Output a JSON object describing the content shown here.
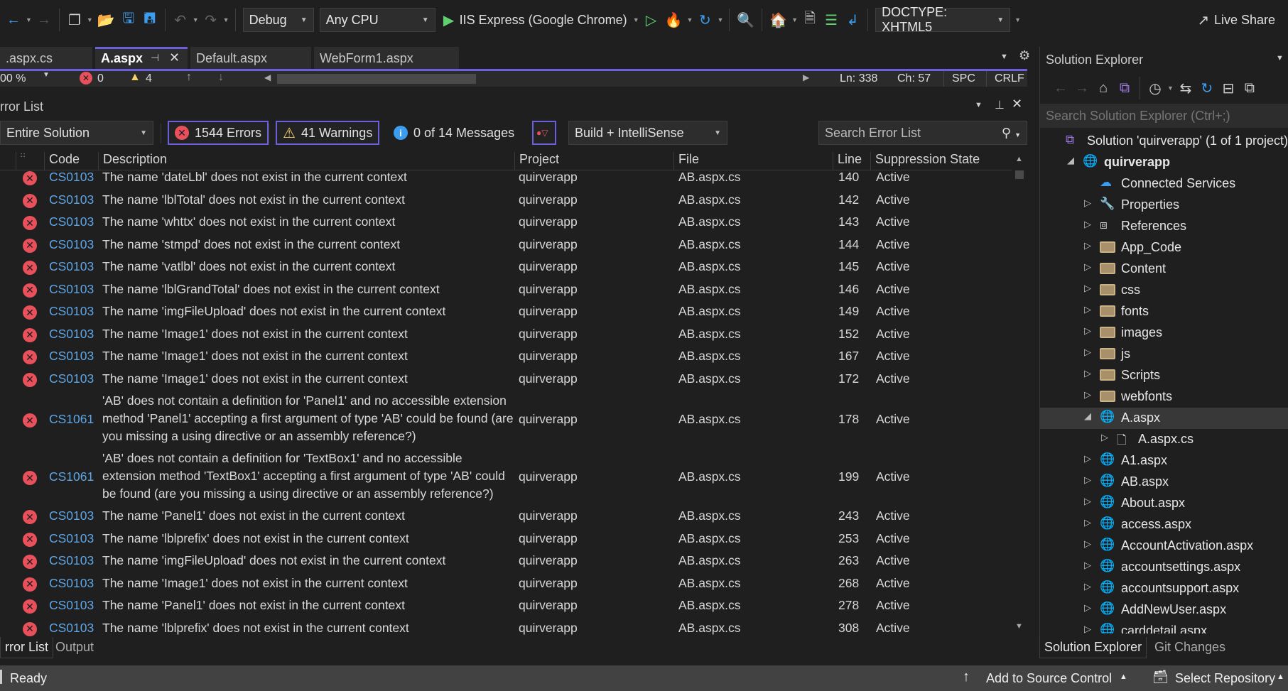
{
  "toolbar": {
    "config": "Debug",
    "platform": "Any CPU",
    "run_target": "IIS Express (Google Chrome)",
    "doctype": "DOCTYPE: XHTML5",
    "live_share": "Live Share"
  },
  "doc_tabs": [
    {
      "label": ".aspx.cs",
      "active": false
    },
    {
      "label": "A.aspx",
      "active": true
    },
    {
      "label": "Default.aspx",
      "active": false
    },
    {
      "label": "WebForm1.aspx",
      "active": false
    }
  ],
  "editor_status": {
    "zoom": "00 %",
    "errors": "0",
    "warnings": "4",
    "ln": "Ln: 338",
    "ch": "Ch: 57",
    "spc": "SPC",
    "crlf": "CRLF"
  },
  "error_list": {
    "title": "rror List",
    "scope": "Entire Solution",
    "errors_btn": "1544 Errors",
    "warnings_btn": "41 Warnings",
    "messages_btn": "0 of 14 Messages",
    "source": "Build + IntelliSense",
    "search_placeholder": "Search Error List",
    "columns": {
      "code": "Code",
      "description": "Description",
      "project": "Project",
      "file": "File",
      "line": "Line",
      "suppression": "Suppression State"
    },
    "rows": [
      {
        "code": "CS0103",
        "description": "The name 'dateLbl' does not exist in the current context",
        "project": "quirverapp",
        "file": "AB.aspx.cs",
        "line": "140",
        "suppression": "Active"
      },
      {
        "code": "CS0103",
        "description": "The name 'lblTotal' does not exist in the current context",
        "project": "quirverapp",
        "file": "AB.aspx.cs",
        "line": "142",
        "suppression": "Active"
      },
      {
        "code": "CS0103",
        "description": "The name 'whttx' does not exist in the current context",
        "project": "quirverapp",
        "file": "AB.aspx.cs",
        "line": "143",
        "suppression": "Active"
      },
      {
        "code": "CS0103",
        "description": "The name 'stmpd' does not exist in the current context",
        "project": "quirverapp",
        "file": "AB.aspx.cs",
        "line": "144",
        "suppression": "Active"
      },
      {
        "code": "CS0103",
        "description": "The name 'vatlbl' does not exist in the current context",
        "project": "quirverapp",
        "file": "AB.aspx.cs",
        "line": "145",
        "suppression": "Active"
      },
      {
        "code": "CS0103",
        "description": "The name 'lblGrandTotal' does not exist in the current context",
        "project": "quirverapp",
        "file": "AB.aspx.cs",
        "line": "146",
        "suppression": "Active"
      },
      {
        "code": "CS0103",
        "description": "The name 'imgFileUpload' does not exist in the current context",
        "project": "quirverapp",
        "file": "AB.aspx.cs",
        "line": "149",
        "suppression": "Active"
      },
      {
        "code": "CS0103",
        "description": "The name 'Image1' does not exist in the current context",
        "project": "quirverapp",
        "file": "AB.aspx.cs",
        "line": "152",
        "suppression": "Active"
      },
      {
        "code": "CS0103",
        "description": "The name 'Image1' does not exist in the current context",
        "project": "quirverapp",
        "file": "AB.aspx.cs",
        "line": "167",
        "suppression": "Active"
      },
      {
        "code": "CS0103",
        "description": "The name 'Image1' does not exist in the current context",
        "project": "quirverapp",
        "file": "AB.aspx.cs",
        "line": "172",
        "suppression": "Active"
      },
      {
        "code": "CS1061",
        "description": "'AB' does not contain a definition for 'Panel1' and no accessible extension method 'Panel1' accepting a first argument of type 'AB' could be found (are you missing a using directive or an assembly reference?)",
        "project": "quirverapp",
        "file": "AB.aspx.cs",
        "line": "178",
        "suppression": "Active"
      },
      {
        "code": "CS1061",
        "description": "'AB' does not contain a definition for 'TextBox1' and no accessible extension method 'TextBox1' accepting a first argument of type 'AB' could be found (are you missing a using directive or an assembly reference?)",
        "project": "quirverapp",
        "file": "AB.aspx.cs",
        "line": "199",
        "suppression": "Active"
      },
      {
        "code": "CS0103",
        "description": "The name 'Panel1' does not exist in the current context",
        "project": "quirverapp",
        "file": "AB.aspx.cs",
        "line": "243",
        "suppression": "Active"
      },
      {
        "code": "CS0103",
        "description": "The name 'lblprefix' does not exist in the current context",
        "project": "quirverapp",
        "file": "AB.aspx.cs",
        "line": "253",
        "suppression": "Active"
      },
      {
        "code": "CS0103",
        "description": "The name 'imgFileUpload' does not exist in the current context",
        "project": "quirverapp",
        "file": "AB.aspx.cs",
        "line": "263",
        "suppression": "Active"
      },
      {
        "code": "CS0103",
        "description": "The name 'Image1' does not exist in the current context",
        "project": "quirverapp",
        "file": "AB.aspx.cs",
        "line": "268",
        "suppression": "Active"
      },
      {
        "code": "CS0103",
        "description": "The name 'Panel1' does not exist in the current context",
        "project": "quirverapp",
        "file": "AB.aspx.cs",
        "line": "278",
        "suppression": "Active"
      },
      {
        "code": "CS0103",
        "description": "The name 'lblprefix' does not exist in the current context",
        "project": "quirverapp",
        "file": "AB.aspx.cs",
        "line": "308",
        "suppression": "Active"
      }
    ]
  },
  "bottom_tabs": [
    "rror List",
    "Output"
  ],
  "solution_explorer": {
    "title": "Solution Explorer",
    "search_placeholder": "Search Solution Explorer (Ctrl+;)",
    "tree": [
      {
        "label": "Solution 'quirverapp' (1 of 1 project)",
        "icon": "solution-icon",
        "depth": 0,
        "twisty": ""
      },
      {
        "label": "quirverapp",
        "icon": "web-project-icon",
        "depth": 1,
        "twisty": "expanded",
        "bold": true
      },
      {
        "label": "Connected Services",
        "icon": "connected-services-icon",
        "depth": 2,
        "twisty": ""
      },
      {
        "label": "Properties",
        "icon": "wrench-icon",
        "depth": 2,
        "twisty": "collapsed"
      },
      {
        "label": "References",
        "icon": "references-icon",
        "depth": 2,
        "twisty": "collapsed"
      },
      {
        "label": "App_Code",
        "icon": "folder-icon",
        "depth": 2,
        "twisty": "collapsed"
      },
      {
        "label": "Content",
        "icon": "folder-icon",
        "depth": 2,
        "twisty": "collapsed"
      },
      {
        "label": "css",
        "icon": "folder-icon",
        "depth": 2,
        "twisty": "collapsed"
      },
      {
        "label": "fonts",
        "icon": "folder-icon",
        "depth": 2,
        "twisty": "collapsed"
      },
      {
        "label": "images",
        "icon": "folder-icon",
        "depth": 2,
        "twisty": "collapsed"
      },
      {
        "label": "js",
        "icon": "folder-icon",
        "depth": 2,
        "twisty": "collapsed"
      },
      {
        "label": "Scripts",
        "icon": "folder-icon",
        "depth": 2,
        "twisty": "collapsed"
      },
      {
        "label": "webfonts",
        "icon": "folder-icon",
        "depth": 2,
        "twisty": "collapsed"
      },
      {
        "label": "A.aspx",
        "icon": "web-page-icon",
        "depth": 2,
        "twisty": "expanded",
        "selected": true
      },
      {
        "label": "A.aspx.cs",
        "icon": "code-file-icon",
        "depth": 3,
        "twisty": "collapsed"
      },
      {
        "label": "A1.aspx",
        "icon": "web-page-icon",
        "depth": 2,
        "twisty": "collapsed"
      },
      {
        "label": "AB.aspx",
        "icon": "web-page-icon",
        "depth": 2,
        "twisty": "collapsed"
      },
      {
        "label": "About.aspx",
        "icon": "web-page-icon",
        "depth": 2,
        "twisty": "collapsed"
      },
      {
        "label": "access.aspx",
        "icon": "web-page-icon",
        "depth": 2,
        "twisty": "collapsed"
      },
      {
        "label": "AccountActivation.aspx",
        "icon": "web-page-icon",
        "depth": 2,
        "twisty": "collapsed"
      },
      {
        "label": "accountsettings.aspx",
        "icon": "web-page-icon",
        "depth": 2,
        "twisty": "collapsed"
      },
      {
        "label": "accountsupport.aspx",
        "icon": "web-page-icon",
        "depth": 2,
        "twisty": "collapsed"
      },
      {
        "label": "AddNewUser.aspx",
        "icon": "web-page-icon",
        "depth": 2,
        "twisty": "collapsed"
      },
      {
        "label": "carddetail.aspx",
        "icon": "web-page-icon",
        "depth": 2,
        "twisty": "collapsed"
      }
    ],
    "tabs": [
      "Solution Explorer",
      "Git Changes"
    ]
  },
  "status_bar": {
    "state": "Ready",
    "source_control": "Add to Source Control",
    "repository": "Select Repository"
  },
  "colors": {
    "accent": "#6b5fdb",
    "error": "#e8515c",
    "warning": "#f5d36b",
    "info": "#3c9cf0",
    "code_link": "#5ea6e6"
  }
}
